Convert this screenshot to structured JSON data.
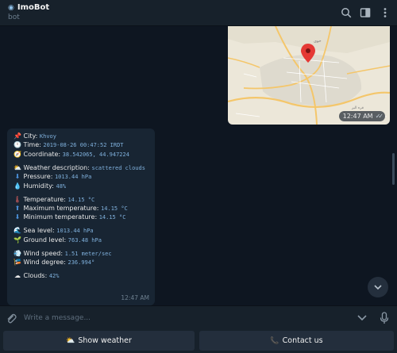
{
  "header": {
    "bot_icon": "robot-icon",
    "title": "ImoBot",
    "subtitle": "bot",
    "icons": [
      "search-icon",
      "sidebar-icon",
      "more-icon"
    ]
  },
  "map_message": {
    "time": "12:47 AM",
    "status_icon": "double-check-icon"
  },
  "info_message": {
    "city": {
      "icon": "pin-icon",
      "label": "City:",
      "value": "Khvoy"
    },
    "time": {
      "icon": "clock-icon",
      "label": "Time:",
      "value": "2019-08-26 00:47:52 IRDT"
    },
    "coordinate": {
      "icon": "compass-icon",
      "label": "Coordinate:",
      "value": "38.542065, 44.947224"
    },
    "weather_description": {
      "icon": "sun-cloud-icon",
      "label": "Weather description:",
      "value": "scattered clouds"
    },
    "pressure": {
      "icon": "down-arrow-icon",
      "label": "Pressure:",
      "value": "1013.44 hPa"
    },
    "humidity": {
      "icon": "droplet-icon",
      "label": "Humidity:",
      "value": "48%"
    },
    "temperature": {
      "icon": "thermometer-icon",
      "label": "Temperature:",
      "value": "14.15 °C"
    },
    "max_temperature": {
      "icon": "up-arrow-icon",
      "label": "Maximum temperature:",
      "value": "14.15 °C"
    },
    "min_temperature": {
      "icon": "down-arrow-icon",
      "label": "Minimum temperature:",
      "value": "14.15 °C"
    },
    "sea_level": {
      "icon": "wave-icon",
      "label": "Sea level:",
      "value": "1013.44 hPa"
    },
    "ground_level": {
      "icon": "plant-icon",
      "label": "Ground level:",
      "value": "763.48 hPa"
    },
    "wind_speed": {
      "icon": "wind-icon",
      "label": "Wind speed:",
      "value": "1.51 meter/sec"
    },
    "wind_degree": {
      "icon": "flag-icon",
      "label": "Wind degree:",
      "value": "236.994°"
    },
    "clouds": {
      "icon": "cloud-icon",
      "label": "Clouds:",
      "value": "42%"
    },
    "time_sent": "12:47 AM"
  },
  "composer": {
    "placeholder": "Write a message..."
  },
  "keyboard": {
    "show_weather": {
      "icon": "sun-cloud-icon",
      "label": "Show weather"
    },
    "contact_us": {
      "icon": "phone-icon",
      "label": "Contact us"
    }
  },
  "colors": {
    "background": "#0e1621",
    "panel": "#17212b",
    "bubble": "#182533",
    "value_text": "#7fb0dc",
    "map_pin": "#e53935"
  }
}
